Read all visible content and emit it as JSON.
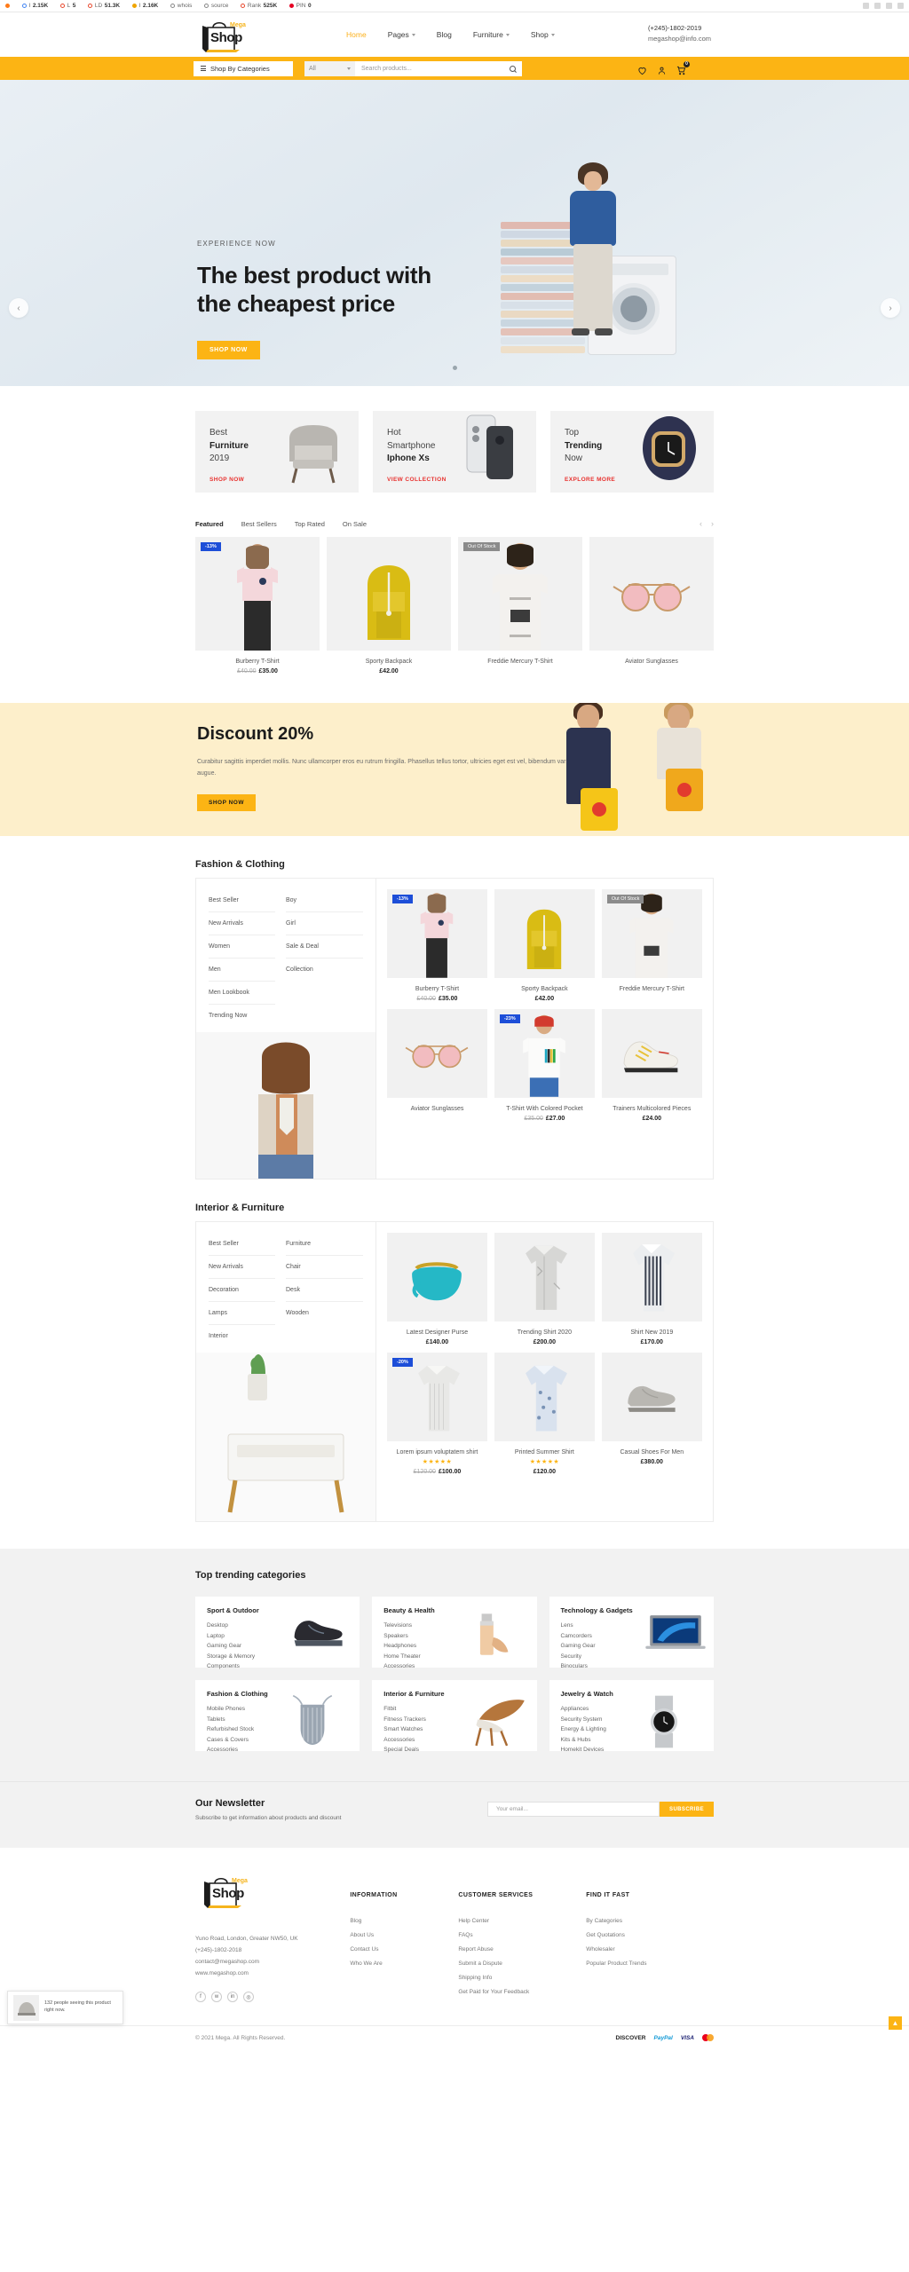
{
  "extension_bar": {
    "items": [
      {
        "icon": "moz-icon",
        "label": "",
        "value": ""
      },
      {
        "icon": "google-icon",
        "label": "I",
        "value": "2.15K"
      },
      {
        "icon": "circle-icon",
        "label": "L",
        "value": "5"
      },
      {
        "icon": "circle-icon",
        "label": "LD",
        "value": "51.3K"
      },
      {
        "icon": "majestic-icon",
        "label": "I",
        "value": "2.16K"
      },
      {
        "icon": "whois-icon",
        "label": "whois",
        "value": ""
      },
      {
        "icon": "source-icon",
        "label": "source",
        "value": ""
      },
      {
        "icon": "rank-icon",
        "label": "Rank",
        "value": "525K"
      },
      {
        "icon": "pinterest-icon",
        "label": "PIN",
        "value": "0"
      }
    ]
  },
  "header": {
    "logo": {
      "top": "Mega",
      "main": "Shop"
    },
    "nav": [
      {
        "label": "Home",
        "has_caret": false,
        "active": true
      },
      {
        "label": "Pages",
        "has_caret": true,
        "active": false
      },
      {
        "label": "Blog",
        "has_caret": false,
        "active": false
      },
      {
        "label": "Furniture",
        "has_caret": true,
        "active": false
      },
      {
        "label": "Shop",
        "has_caret": true,
        "active": false
      }
    ],
    "phone": "(+245)-1802-2019",
    "email": "megashop@info.com"
  },
  "searchbar": {
    "categories_button": "Shop By Categories",
    "select_value": "All",
    "search_placeholder": "Search products...",
    "cart_count": "0"
  },
  "hero": {
    "eyebrow": "EXPERIENCE NOW",
    "title_line1": "The best product with",
    "title_line2": "the cheapest price",
    "button": "SHOP NOW",
    "prev": "‹",
    "next": "›"
  },
  "promos": [
    {
      "line1": "Best",
      "line2": "Furniture",
      "line3": "2019",
      "link": "SHOP NOW",
      "image": "armchair"
    },
    {
      "line1": "Hot",
      "line2": "Smartphone",
      "line3": "Iphone Xs",
      "link": "VIEW COLLECTION",
      "image": "iphone"
    },
    {
      "line1": "Top",
      "line2": "Trending",
      "line3": "Now",
      "link": "EXPLORE MORE",
      "image": "smartwatch"
    }
  ],
  "featured": {
    "tabs": [
      "Featured",
      "Best Sellers",
      "Top Rated",
      "On Sale"
    ],
    "active_tab": "Featured",
    "products": [
      {
        "name": "Burberry T-Shirt",
        "price": "£35.00",
        "old_price": "£40.00",
        "badge": "-13%",
        "badge_type": "sale",
        "image": "pink-tshirt-model"
      },
      {
        "name": "Sporty Backpack",
        "price": "£42.00",
        "old_price": "",
        "badge": "",
        "badge_type": "",
        "image": "yellow-backpack"
      },
      {
        "name": "Freddie Mercury T-Shirt",
        "price": "",
        "old_price": "",
        "badge": "Out Of Stock",
        "badge_type": "oos",
        "image": "white-tshirt-model"
      },
      {
        "name": "Aviator Sunglasses",
        "price": "",
        "old_price": "",
        "badge": "",
        "badge_type": "",
        "image": "pink-sunglasses"
      }
    ]
  },
  "discount": {
    "title": "Discount 20%",
    "text": "Curabitur sagittis imperdiet mollis. Nunc ullamcorper eros eu rutrum fringilla. Phasellus tellus tortor, ultricies eget est vel, bibendum varius augue.",
    "button": "SHOP NOW"
  },
  "fashion": {
    "heading": "Fashion & Clothing",
    "links_col1": [
      "Best Seller",
      "New Arrivals",
      "Women",
      "Men",
      "Men Lookbook",
      "Trending Now"
    ],
    "links_col2": [
      "Boy",
      "Girl",
      "Sale & Deal",
      "Collection"
    ],
    "products": [
      {
        "name": "Burberry T-Shirt",
        "price": "£35.00",
        "old_price": "£40.00",
        "badge": "-13%",
        "badge_type": "sale",
        "stars": "",
        "image": "pink-tshirt-model"
      },
      {
        "name": "Sporty Backpack",
        "price": "£42.00",
        "old_price": "",
        "badge": "",
        "badge_type": "",
        "stars": "",
        "image": "yellow-backpack"
      },
      {
        "name": "Freddie Mercury T-Shirt",
        "price": "",
        "old_price": "",
        "badge": "Out Of Stock",
        "badge_type": "oos",
        "stars": "",
        "image": "white-tshirt-model"
      },
      {
        "name": "Aviator Sunglasses",
        "price": "",
        "old_price": "",
        "badge": "",
        "badge_type": "",
        "stars": "",
        "image": "pink-sunglasses"
      },
      {
        "name": "T-Shirt With Colored Pocket",
        "price": "£27.00",
        "old_price": "£35.00",
        "badge": "-23%",
        "badge_type": "sale",
        "stars": "",
        "image": "pocket-tshirt-model"
      },
      {
        "name": "Trainers Multicolored Pieces",
        "price": "£24.00",
        "old_price": "",
        "badge": "",
        "badge_type": "",
        "stars": "",
        "image": "sneakers"
      }
    ]
  },
  "interior": {
    "heading": "Interior & Furniture",
    "links_col1": [
      "Best Seller",
      "New Arrivals",
      "Decoration",
      "Lamps",
      "Interior"
    ],
    "links_col2": [
      "Furniture",
      "Chair",
      "Desk",
      "Wooden"
    ],
    "products": [
      {
        "name": "Latest Designer Purse",
        "price": "£140.00",
        "old_price": "",
        "badge": "",
        "badge_type": "",
        "stars": "",
        "image": "teal-purse"
      },
      {
        "name": "Trending Shirt 2020",
        "price": "£200.00",
        "old_price": "",
        "badge": "",
        "badge_type": "",
        "stars": "",
        "image": "grey-shirt"
      },
      {
        "name": "Shirt New 2019",
        "price": "£170.00",
        "old_price": "",
        "badge": "",
        "badge_type": "",
        "stars": "",
        "image": "striped-shirt"
      },
      {
        "name": "Lorem ipsum voluptatem shirt",
        "price": "£100.00",
        "old_price": "£120.00",
        "badge": "-20%",
        "badge_type": "sale",
        "stars": "★★★★★",
        "image": "knit-shirt"
      },
      {
        "name": "Printed Summer Shirt",
        "price": "£120.00",
        "old_price": "",
        "badge": "",
        "badge_type": "",
        "stars": "★★★★★",
        "image": "printed-shirt"
      },
      {
        "name": "Casual Shoes For Men",
        "price": "£380.00",
        "old_price": "",
        "badge": "",
        "badge_type": "",
        "stars": "",
        "image": "casual-shoe"
      }
    ]
  },
  "trending": {
    "title": "Top trending categories",
    "cards": [
      {
        "title": "Sport & Outdoor",
        "items": [
          "Desktop",
          "Laptop",
          "Gaming Gear",
          "Storage & Memory",
          "Components"
        ],
        "image": "sport-shoe"
      },
      {
        "title": "Beauty & Health",
        "items": [
          "Televisions",
          "Speakers",
          "Headphones",
          "Home Theater",
          "Accessories"
        ],
        "image": "foundation-bottle"
      },
      {
        "title": "Technology & Gadgets",
        "items": [
          "Lens",
          "Camcorders",
          "Gaming Gear",
          "Security",
          "Binoculars"
        ],
        "image": "laptop"
      },
      {
        "title": "Fashion & Clothing",
        "items": [
          "Mobile Phones",
          "Tablets",
          "Refurbished Stock",
          "Cases & Covers",
          "Accessories"
        ],
        "image": "swimsuit"
      },
      {
        "title": "Interior & Furniture",
        "items": [
          "Fitbit",
          "Fitness Trackers",
          "Smart Watches",
          "Accessories",
          "Special Deals"
        ],
        "image": "wooden-chair"
      },
      {
        "title": "Jewelry & Watch",
        "items": [
          "Appliances",
          "Security System",
          "Energy & Lighting",
          "Kits & Hubs",
          "Homekit Devices"
        ],
        "image": "wristwatch"
      }
    ]
  },
  "newsletter": {
    "title": "Our Newsletter",
    "subtitle": "Subscribe to get information about products and discount",
    "placeholder": "Your email...",
    "button": "SUBSCRIBE"
  },
  "footer": {
    "logo": {
      "top": "Mega",
      "main": "Shop"
    },
    "address": "Yuno Road, London, Greater NW50, UK",
    "phone": "(+245)-1802-2018",
    "email": "contact@megashop.com",
    "website": "www.megashop.com",
    "social": [
      "facebook-icon",
      "twitter-icon",
      "linkedin-icon",
      "instagram-icon"
    ],
    "columns": [
      {
        "heading": "INFORMATION",
        "links": [
          "Blog",
          "About Us",
          "Contact Us",
          "Who We Are"
        ]
      },
      {
        "heading": "CUSTOMER SERVICES",
        "links": [
          "Help Center",
          "FAQs",
          "Report Abuse",
          "Submit a Dispute",
          "Shipping Info",
          "Get Paid for Your Feedback"
        ]
      },
      {
        "heading": "FIND IT FAST",
        "links": [
          "By Categories",
          "Get Quotations",
          "Wholesaler",
          "Popular Product Trends"
        ]
      }
    ],
    "copyright": "© 2021 Mega. All Rights Reserved.",
    "payments": [
      "DISCOVER",
      "PayPal",
      "VISA",
      "mastercard"
    ]
  },
  "live_popup": {
    "text": "132 people seeing this product right now."
  },
  "back_to_top": "▲"
}
